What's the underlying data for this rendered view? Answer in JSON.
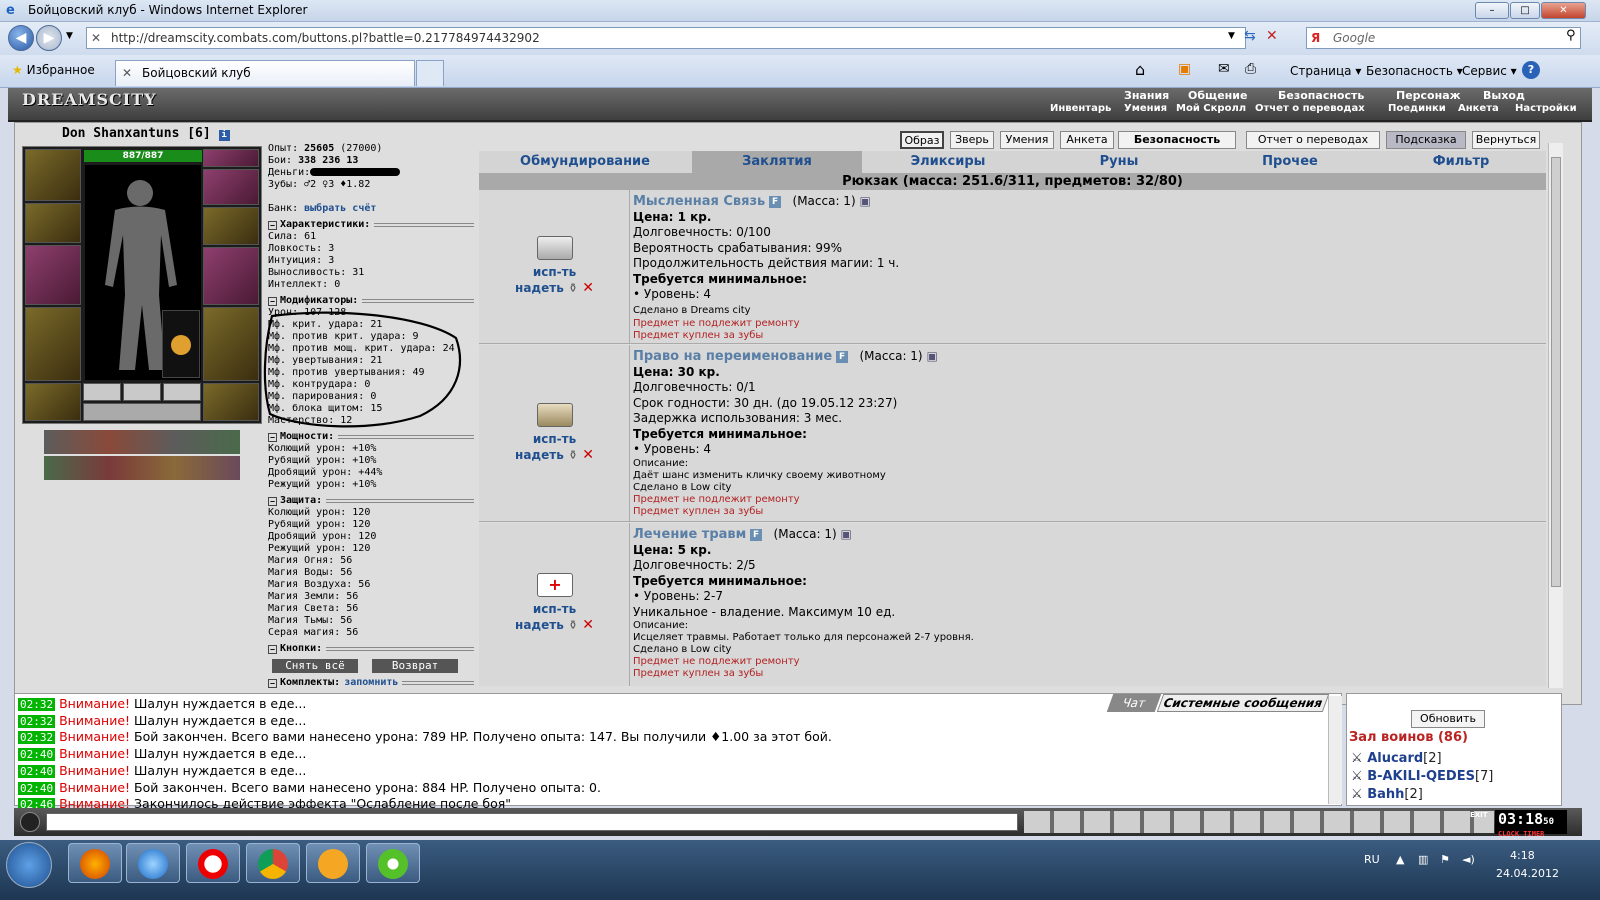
{
  "window": {
    "title": "Бойцовский клуб - Windows Internet Explorer",
    "controls": [
      "–",
      "□",
      "✕"
    ]
  },
  "browser": {
    "address": "http://dreamscity.combats.com/buttons.pl?battle=0.217784974432902",
    "search_placeholder": "Google",
    "favorites_label": "Избранное",
    "tab_title": "Бойцовский клуб",
    "commands": [
      "Страница ▾",
      "Безопасность ▾",
      "Сервис ▾"
    ]
  },
  "game_header": {
    "logo": "DREAMSCITY",
    "nav": [
      "Знания",
      "Общение",
      "Безопасность",
      "Персонаж",
      "Выход"
    ],
    "subnav": [
      "Инвентарь",
      "Умения",
      "Мой Скролл",
      "Отчет о переводах",
      "Поединки",
      "Анкета",
      "Настройки"
    ]
  },
  "character": {
    "name": "Don Shanxantuns",
    "level": "[6]",
    "hp": "887/887",
    "exp_label": "Опыт:",
    "exp": "25605",
    "exp_next": "(27000)",
    "fights_label": "Бои:",
    "wins": "338",
    "losses": "236",
    "draws": "13",
    "money_label": "Деньги:",
    "teeth": "Зубы: ♂2 ♀3 ♦1.82",
    "bank_label": "Банк:",
    "bank_link": "выбрать счёт"
  },
  "stats": {
    "title": "Характеристики:",
    "items": [
      "Сила: 61",
      "Ловкость: 3",
      "Интуиция: 3",
      "Выносливость: 31",
      "Интеллект: 0"
    ]
  },
  "modifiers": {
    "title": "Модификаторы:",
    "items": [
      "Урон: 107-128",
      "Мф. крит. удара: 21",
      "Мф. против крит. удара: 9",
      "Мф. против мощ. крит. удара: 24",
      "Мф. увертывания: 21",
      "Мф. против увертывания: 49",
      "Мф. контрудара: 0",
      "Мф. парирования: 0",
      "Мф. блока щитом: 15",
      "Мастерство: 12"
    ]
  },
  "powers": {
    "title": "Мощности:",
    "items": [
      "Колющий урон: +10%",
      "Рубящий урон: +10%",
      "Дробящий урон: +44%",
      "Режущий урон: +10%"
    ]
  },
  "defense": {
    "title": "Защита:",
    "items": [
      "Колющий урон: 120",
      "Рубящий урон: 120",
      "Дробящий урон: 120",
      "Режущий урон: 120",
      "Магия Огня: 56",
      "Магия Воды: 56",
      "Магия Воздуха: 56",
      "Магия Земли: 56",
      "Магия Света: 56",
      "Магия Тьмы: 56",
      "Серая магия: 56"
    ]
  },
  "buttons_section": {
    "title": "Кнопки:",
    "remove_all": "Снять всё",
    "return": "Возврат"
  },
  "sets_section": {
    "title": "Комплекты:",
    "remember": "запомнить"
  },
  "top_buttons": [
    "Образ",
    "Зверь",
    "Умения",
    "Анкета",
    "Безопасность",
    "Отчет о переводах",
    "Подсказка",
    "Вернуться"
  ],
  "categories": [
    "Обмундирование",
    "Заклятия",
    "Эликсиры",
    "Руны",
    "Прочее",
    "Фильтр"
  ],
  "selected_category": "Заклятия",
  "backpack": "Рюкзак (масса: 251.6/311, предметов: 32/80)",
  "item_actions": {
    "use": "исп-ть",
    "wear": "надеть"
  },
  "items": [
    {
      "name": "Мысленная Связь",
      "mass": "(Масса: 1)",
      "lines": [
        "Цена: 1 кр.",
        "Долговечность: 0/100",
        "Вероятность срабатывания: 99%",
        "Продолжительность действия магии: 1 ч."
      ],
      "req_title": "Требуется минимальное:",
      "req": "• Уровень: 4",
      "small": [
        "Сделано в Dreams city"
      ],
      "red": [
        "Предмет не подлежит ремонту",
        "Предмет куплен за зубы"
      ]
    },
    {
      "name": "Право на переименование",
      "mass": "(Масса: 1)",
      "lines": [
        "Цена: 30 кр.",
        "Долговечность: 0/1",
        "Срок годности: 30 дн. (до 19.05.12 23:27)",
        "Задержка использования: 3 мес."
      ],
      "req_title": "Требуется минимальное:",
      "req": "• Уровень: 4",
      "small": [
        "Описание:",
        "Даёт шанс изменить кличку своему животному",
        "Сделано в Low city"
      ],
      "red": [
        "Предмет не подлежит ремонту",
        "Предмет куплен за зубы"
      ]
    },
    {
      "name": "Лечение травм",
      "mass": "(Масса: 1)",
      "lines": [
        "Цена: 5 кр.",
        "Долговечность: 2/5"
      ],
      "req_title": "Требуется минимальное:",
      "req": "• Уровень: 2-7",
      "extra": "Уникальное - владение. Максимум 10 ед.",
      "small": [
        "Описание:",
        "Исцеляет травмы. Работает только для персонажей 2-7 уровня.",
        "Сделано в Low city"
      ],
      "red": [
        "Предмет не подлежит ремонту",
        "Предмет куплен за зубы"
      ]
    }
  ],
  "chat": {
    "tabs": [
      "Чат",
      "Системные сообщения"
    ],
    "lines": [
      {
        "time": "02:32",
        "warn": "Внимание!",
        "text": " Шалун нуждается в еде..."
      },
      {
        "time": "02:32",
        "warn": "Внимание!",
        "text": " Шалун нуждается в еде..."
      },
      {
        "time": "02:32",
        "warn": "Внимание!",
        "text": " Бой закончен. Всего вами нанесено урона: 789 HP. Получено опыта: 147. Вы получили ♦1.00 за этот бой."
      },
      {
        "time": "02:40",
        "warn": "Внимание!",
        "text": " Шалун нуждается в еде..."
      },
      {
        "time": "02:40",
        "warn": "Внимание!",
        "text": " Шалун нуждается в еде..."
      },
      {
        "time": "02:40",
        "warn": "Внимание!",
        "text": " Бой закончен. Всего вами нанесено урона: 884 HP. Получено опыта: 0."
      },
      {
        "time": "02:46",
        "warn": "Внимание!",
        "text": " Закончилось действие эффекта \"Ослабление после боя\""
      }
    ]
  },
  "room": {
    "refresh": "Обновить",
    "title": "Зал воинов (86)",
    "players": [
      {
        "name": "Alucard",
        "level": "[2]"
      },
      {
        "name": "B-AKILI-QEDES",
        "level": "[7]"
      },
      {
        "name": "Bahh",
        "level": "[2]"
      }
    ]
  },
  "clock": {
    "time": "03:18",
    "sec": "50",
    "labels": [
      "CLOCK",
      "TIMER"
    ],
    "exit": "EXIT"
  },
  "taskbar": {
    "lang": "RU",
    "time": "4:18",
    "date": "24.04.2012"
  },
  "colors": {
    "item_name": "#5a7fa6",
    "category": "#1f4f8f",
    "warn": "#dd0000",
    "time_bg": "#00b400"
  }
}
